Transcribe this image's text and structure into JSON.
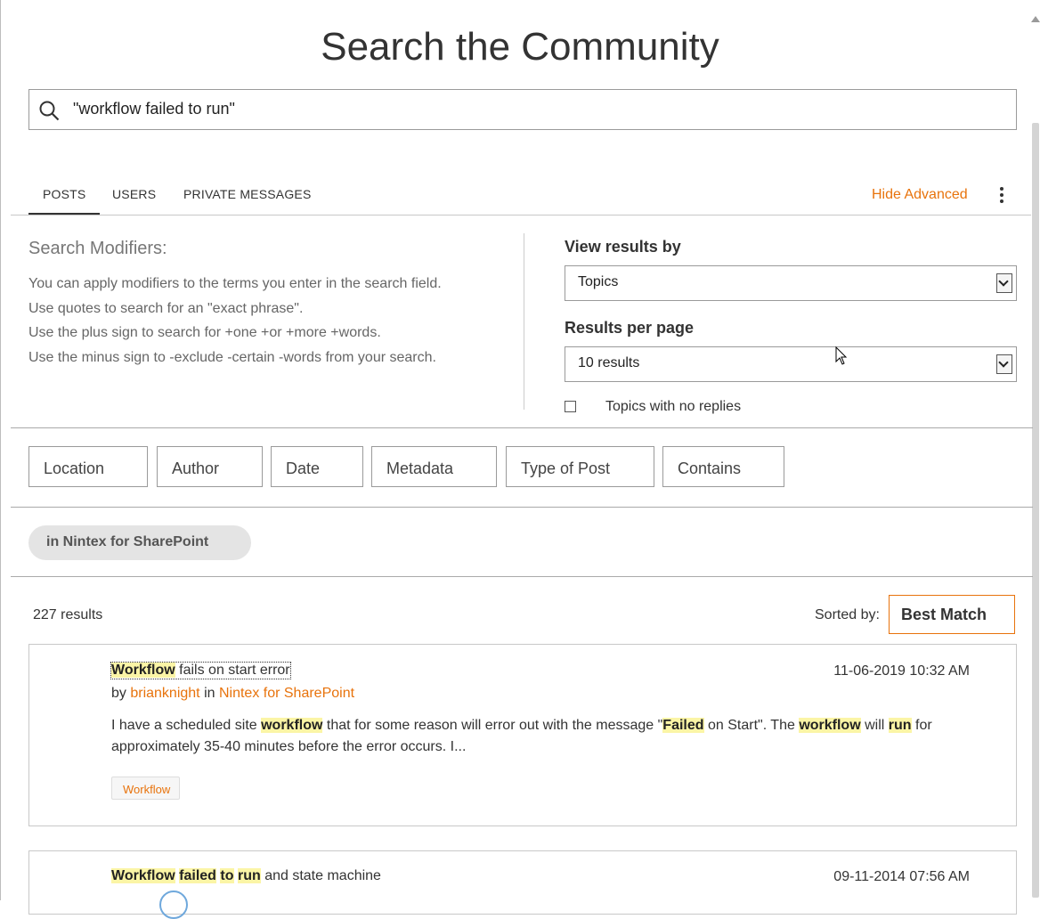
{
  "page": {
    "title": "Search the Community"
  },
  "search": {
    "value": "\"workflow failed to run\"",
    "icon": "search-icon"
  },
  "tabs": [
    {
      "label": "POSTS",
      "active": true
    },
    {
      "label": "USERS",
      "active": false
    },
    {
      "label": "PRIVATE MESSAGES",
      "active": false
    }
  ],
  "advanced": {
    "hide_label": "Hide Advanced",
    "menu_icon": "more-vertical-icon"
  },
  "modifiers": {
    "title": "Search Modifiers:",
    "lines": [
      "You can apply modifiers to the terms you enter in the search field.",
      "Use quotes to search for an \"exact phrase\".",
      "Use the plus sign to search for +one +or +more +words.",
      "Use the minus sign to -exclude -certain -words from your search."
    ]
  },
  "options": {
    "view_by_label": "View results by",
    "view_by_value": "Topics",
    "per_page_label": "Results per page",
    "per_page_value": "10 results",
    "no_replies_label": "Topics with no replies",
    "no_replies_checked": false
  },
  "filters": [
    "Location",
    "Author",
    "Date",
    "Metadata",
    "Type of Post",
    "Contains"
  ],
  "scope_pill": "in Nintex for SharePoint",
  "results": {
    "count_label": "227 results",
    "sorted_by_label": "Sorted by:",
    "sort_value": "Best Match"
  },
  "posts": [
    {
      "title_hl": "Workflow",
      "title_rest": " fails on start error",
      "date": "11-06-2019 10:32 AM",
      "by": "by ",
      "author": "brianknight",
      "in": " in ",
      "board": "Nintex for SharePoint",
      "snippet": [
        {
          "t": "I have a scheduled site ",
          "h": false
        },
        {
          "t": "workflow",
          "h": true
        },
        {
          "t": " that for some reason will error out with the message \"",
          "h": false
        },
        {
          "t": "Failed",
          "h": true
        },
        {
          "t": " on Start\".  The ",
          "h": false
        },
        {
          "t": "workflow",
          "h": true
        },
        {
          "t": " will ",
          "h": false
        },
        {
          "t": "run",
          "h": true
        },
        {
          "t": " for approximately 35-40 minutes before the error occurs.  I...",
          "h": false
        }
      ],
      "tag": "Workflow"
    },
    {
      "title_parts": [
        {
          "t": "Workflow",
          "h": true
        },
        {
          "t": " ",
          "h": false
        },
        {
          "t": "failed",
          "h": true
        },
        {
          "t": " ",
          "h": false
        },
        {
          "t": "to",
          "h": true
        },
        {
          "t": " ",
          "h": false
        },
        {
          "t": "run",
          "h": true
        },
        {
          "t": " and state machine",
          "h": false
        }
      ],
      "date": "09-11-2014 07:56 AM"
    }
  ],
  "colors": {
    "accent": "#e8730c",
    "highlight": "#fbf5a6",
    "border": "#9a9a9a"
  }
}
